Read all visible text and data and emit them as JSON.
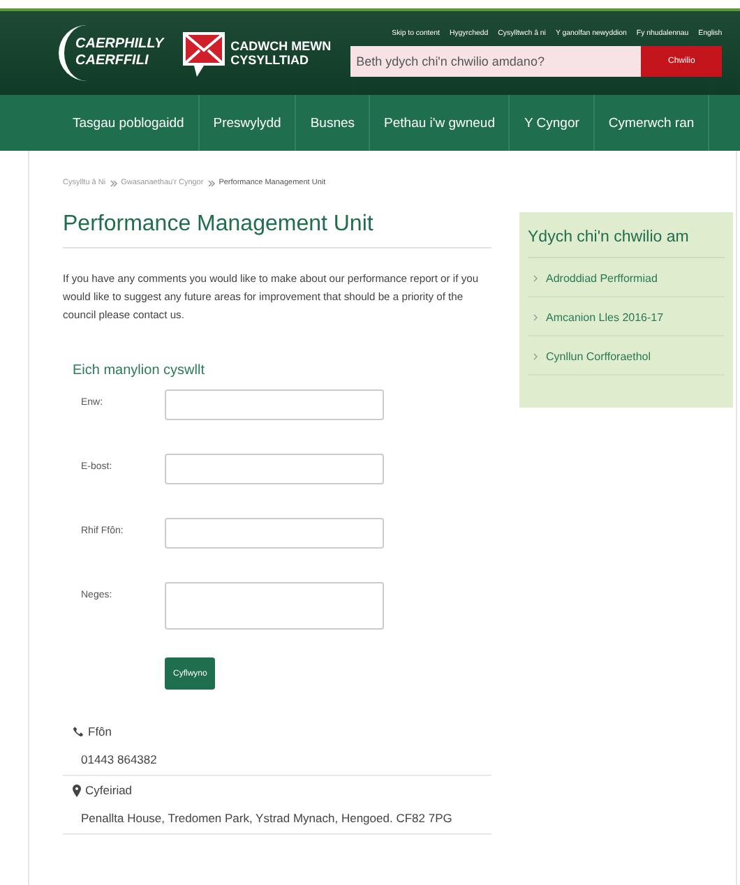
{
  "header": {
    "logo": [
      "CAERPHILLY",
      "CAERFFILI"
    ],
    "campaign": [
      "CADWCH MEWN",
      "CYSYLLTIAD"
    ],
    "top_links": [
      "Skip to content",
      "Hygyrchedd",
      "Cysylltwch â ni",
      "Y ganolfan newyddion",
      "Fy nhudalennau",
      "English"
    ],
    "search": {
      "placeholder": "Beth ydych chi'n chwilio amdano?",
      "button": "Chwilio"
    },
    "nav": [
      "Tasgau poblogaidd",
      "Preswylydd",
      "Busnes",
      "Pethau i'w gwneud",
      "Y Cyngor",
      "Cymerwch ran"
    ]
  },
  "breadcrumb": [
    "Cysylltu â Ni",
    "Gwasanaethau'r Cyngor",
    "Performance Management Unit"
  ],
  "title": "Performance Management Unit",
  "intro": "If you have any comments you would like to make about our performance report or if you would like to suggest any future areas for improvement that should be a priority of the council please contact us.",
  "form": {
    "heading": "Eich manylion cyswllt",
    "fields": [
      {
        "label": "Enw:",
        "kind": "input"
      },
      {
        "label": "E-bost:",
        "kind": "input"
      },
      {
        "label": "Rhif Ffôn:",
        "kind": "input"
      },
      {
        "label": "Neges:",
        "kind": "textarea"
      }
    ],
    "submit": "Cyflwyno"
  },
  "contact": [
    {
      "kind": "phone",
      "label": "Ffôn",
      "value": "01443 864382"
    },
    {
      "kind": "address",
      "label": "Cyfeiriad",
      "value": "Penallta House, Tredomen Park, Ystrad Mynach, Hengoed. CF82 7PG"
    }
  ],
  "sidebar": {
    "title": "Ydych chi'n chwilio am",
    "links": [
      "Adroddiad Perfformiad",
      "Amcanion Lles 2016-17",
      "Cynllun Corfforaethol"
    ]
  }
}
